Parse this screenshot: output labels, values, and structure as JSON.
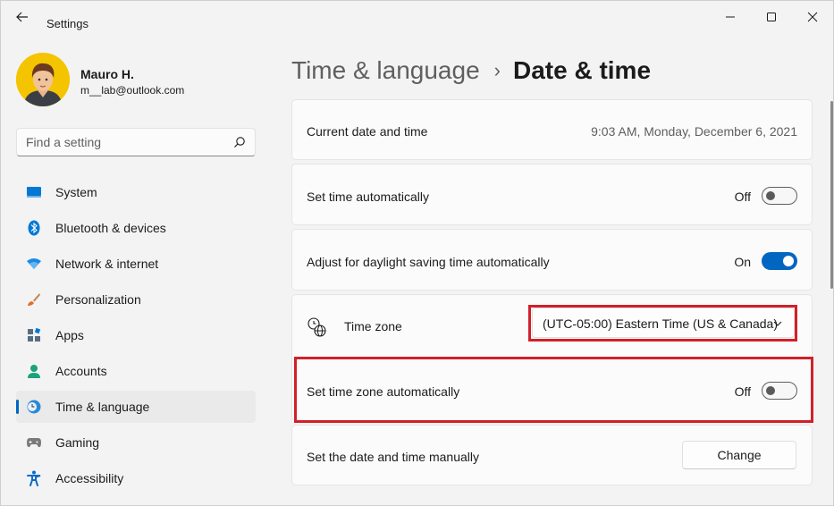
{
  "window": {
    "title": "Settings"
  },
  "profile": {
    "name": "Mauro H.",
    "email": "m__lab@outlook.com"
  },
  "search": {
    "placeholder": "Find a setting"
  },
  "nav": {
    "items": [
      {
        "label": "System",
        "icon": "system-icon"
      },
      {
        "label": "Bluetooth & devices",
        "icon": "bluetooth-icon"
      },
      {
        "label": "Network & internet",
        "icon": "wifi-icon"
      },
      {
        "label": "Personalization",
        "icon": "brush-icon"
      },
      {
        "label": "Apps",
        "icon": "apps-icon"
      },
      {
        "label": "Accounts",
        "icon": "accounts-icon"
      },
      {
        "label": "Time & language",
        "icon": "time-language-icon",
        "active": true
      },
      {
        "label": "Gaming",
        "icon": "gaming-icon"
      },
      {
        "label": "Accessibility",
        "icon": "accessibility-icon"
      }
    ]
  },
  "breadcrumb": {
    "parent": "Time & language",
    "separator": "›",
    "current": "Date & time"
  },
  "settings": {
    "current": {
      "label": "Current date and time",
      "value": "9:03 AM, Monday, December 6, 2021"
    },
    "set_time_auto": {
      "label": "Set time automatically",
      "state": "Off"
    },
    "daylight": {
      "label": "Adjust for daylight saving time automatically",
      "state": "On"
    },
    "timezone": {
      "label": "Time zone",
      "value": "(UTC-05:00) Eastern Time (US & Canada)"
    },
    "set_tz_auto": {
      "label": "Set time zone automatically",
      "state": "Off"
    },
    "manual": {
      "label": "Set the date and time manually",
      "button": "Change"
    }
  },
  "colors": {
    "accent": "#0067c0",
    "highlight": "#d1202a",
    "background": "#f3f3f3",
    "card": "#fbfbfb"
  }
}
